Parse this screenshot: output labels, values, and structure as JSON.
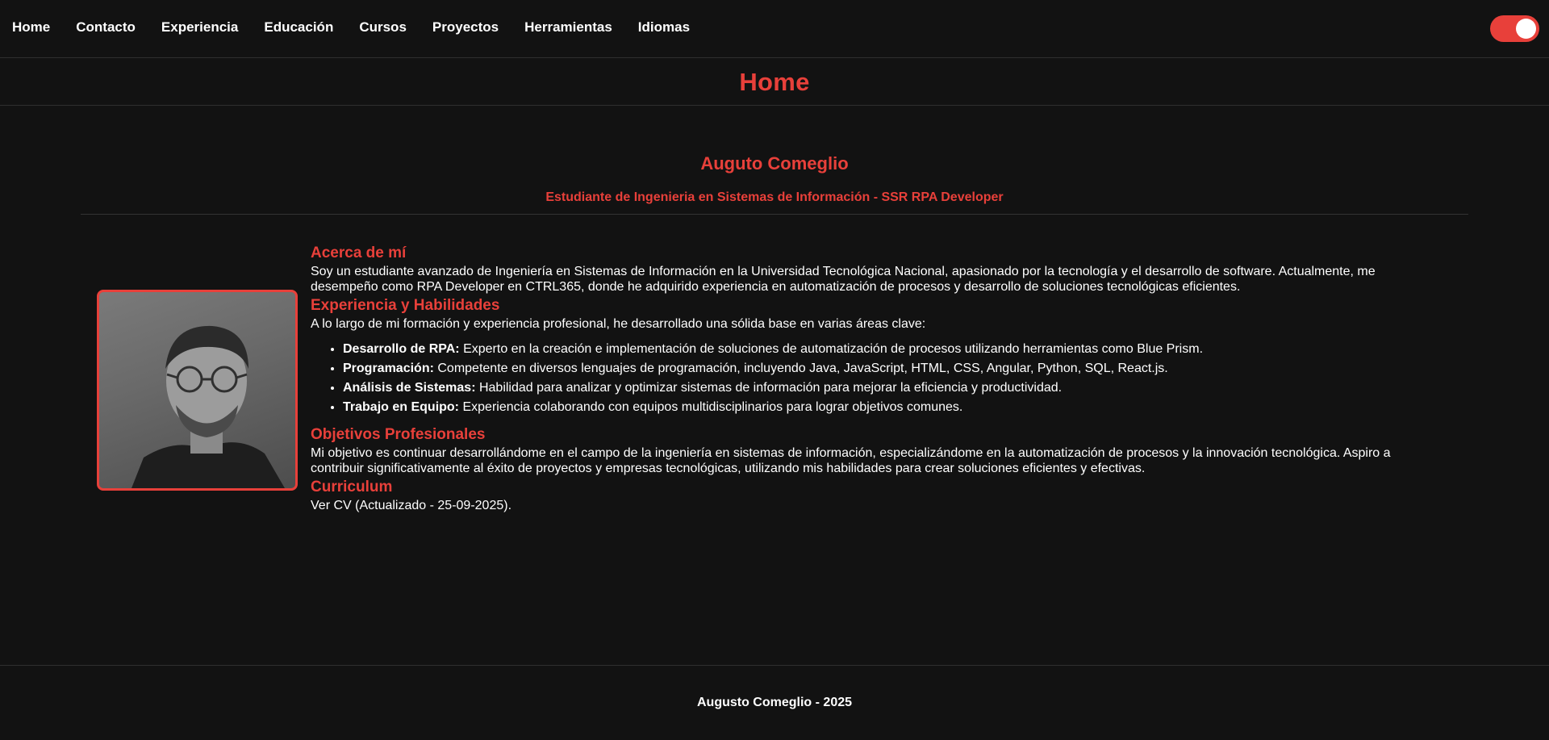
{
  "nav": {
    "links": [
      "Home",
      "Contacto",
      "Experiencia",
      "Educación",
      "Cursos",
      "Proyectos",
      "Herramientas",
      "Idiomas"
    ]
  },
  "header": {
    "title": "Home"
  },
  "profile": {
    "name": "Auguto Comeglio",
    "subtitle": "Estudiante de Ingenieria en Sistemas de Información - SSR RPA Developer"
  },
  "sections": {
    "about": {
      "heading": "Acerca de mí",
      "text": "Soy un estudiante avanzado de Ingeniería en Sistemas de Información en la Universidad Tecnológica Nacional, apasionado por la tecnología y el desarrollo de software. Actualmente, me desempeño como RPA Developer en CTRL365, donde he adquirido experiencia en automatización de procesos y desarrollo de soluciones tecnológicas eficientes."
    },
    "experience": {
      "heading": "Experiencia y Habilidades",
      "intro": "A lo largo de mi formación y experiencia profesional, he desarrollado una sólida base en varias áreas clave:",
      "items": [
        {
          "label": "Desarrollo de RPA:",
          "text": "Experto en la creación e implementación de soluciones de automatización de procesos utilizando herramientas como Blue Prism."
        },
        {
          "label": "Programación:",
          "text": "Competente en diversos lenguajes de programación, incluyendo Java, JavaScript, HTML, CSS, Angular, Python, SQL, React.js."
        },
        {
          "label": "Análisis de Sistemas:",
          "text": "Habilidad para analizar y optimizar sistemas de información para mejorar la eficiencia y productividad."
        },
        {
          "label": "Trabajo en Equipo:",
          "text": "Experiencia colaborando con equipos multidisciplinarios para lograr objetivos comunes."
        }
      ]
    },
    "goals": {
      "heading": "Objetivos Profesionales",
      "text": "Mi objetivo es continuar desarrollándome en el campo de la ingeniería en sistemas de información, especializándome en la automatización de procesos y la innovación tecnológica. Aspiro a contribuir significativamente al éxito de proyectos y empresas tecnológicas, utilizando mis habilidades para crear soluciones eficientes y efectivas."
    },
    "cv": {
      "heading": "Curriculum",
      "text": "Ver CV (Actualizado - 25-09-2025)."
    }
  },
  "footer": {
    "text": "Augusto Comeglio - 2025"
  },
  "theme": {
    "accent": "#e8403a",
    "background": "#121212",
    "toggle_state": "on"
  }
}
